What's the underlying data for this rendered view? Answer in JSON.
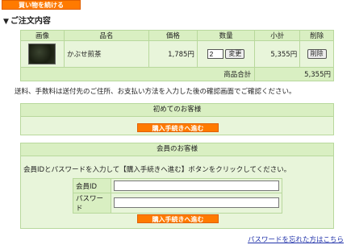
{
  "top": {
    "continue_shopping": "買い物を続ける"
  },
  "section_title": "ご注文内容",
  "cart": {
    "headers": [
      "画像",
      "品名",
      "価格",
      "数量",
      "小計",
      "削除"
    ],
    "items": [
      {
        "name": "かぶせ煎茶",
        "price": "1,785円",
        "quantity": "2",
        "update_label": "変更",
        "subtotal": "5,355円",
        "delete_label": "削除"
      }
    ],
    "total_label": "商品合計",
    "total_value": "5,355円"
  },
  "notice": "送料、手数料は送付先のご住所、お支払い方法を入力した後の確認画面でご確認ください。",
  "first_time": {
    "title": "初めてのお客様",
    "proceed_label": "購入手続きへ進む"
  },
  "member": {
    "title": "会員のお客様",
    "instructions": "会員IDとパスワードを入力して【購入手続きへ進む】ボタンをクリックしてください。",
    "id_label": "会員ID",
    "password_label": "パスワード",
    "proceed_label": "購入手続きへ進む"
  },
  "forgot_password": "パスワードを忘れた方はこちら",
  "colors": {
    "accent": "#ff7a00",
    "panel": "#d9efc2",
    "link": "#2233aa"
  }
}
